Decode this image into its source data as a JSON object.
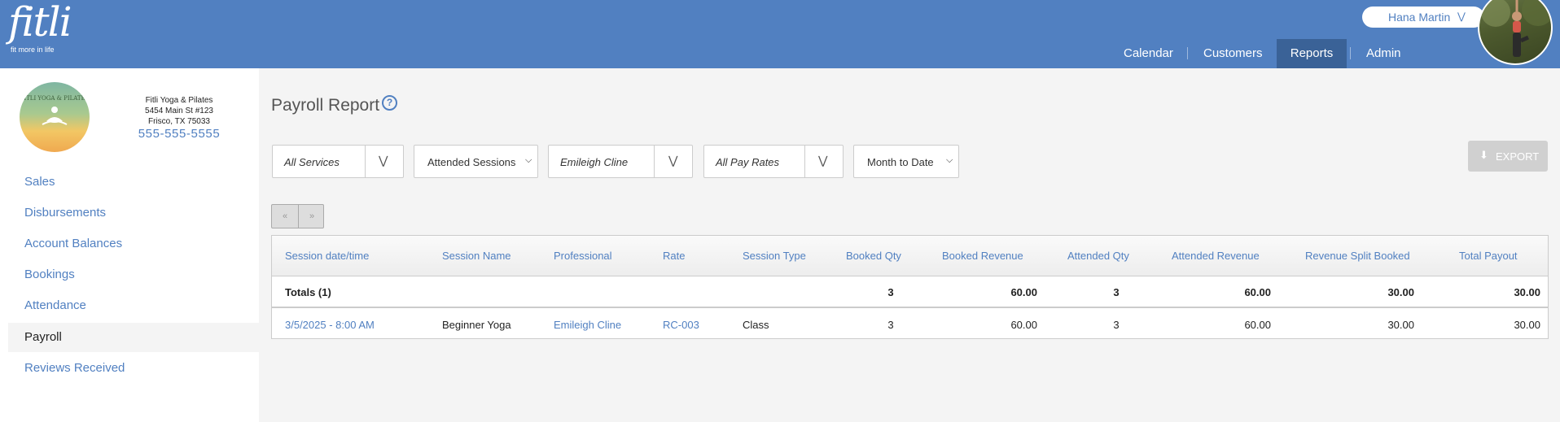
{
  "header": {
    "logo_text": "fitli",
    "logo_tagline": "fit more in life",
    "user_name": "Hana Martin",
    "nav": [
      {
        "label": "Calendar"
      },
      {
        "label": "Customers"
      },
      {
        "label": "Reports",
        "active": true
      },
      {
        "label": "Admin"
      }
    ]
  },
  "studio": {
    "name": "Fitli Yoga & Pilates",
    "address1": "5454 Main St #123",
    "address2": "Frisco, TX 75033",
    "phone": "555-555-5555",
    "logo_text": "FITLI YOGA & PILATES"
  },
  "sidebar": {
    "items": [
      {
        "label": "Sales"
      },
      {
        "label": "Disbursements"
      },
      {
        "label": "Account Balances"
      },
      {
        "label": "Bookings"
      },
      {
        "label": "Attendance"
      },
      {
        "label": "Payroll",
        "active": true
      },
      {
        "label": "Reviews Received"
      }
    ]
  },
  "page": {
    "title": "Payroll Report",
    "help": "?"
  },
  "filters": {
    "services": "All Services",
    "sessions": "Attended Sessions",
    "professional": "Emileigh Cline",
    "pay_rates": "All Pay Rates",
    "date_range": "Month to Date"
  },
  "export_label": "EXPORT",
  "pager": {
    "prev": "«",
    "next": "»"
  },
  "table": {
    "columns": [
      "Session date/time",
      "Session Name",
      "Professional",
      "Rate",
      "Session Type",
      "Booked Qty",
      "Booked Revenue",
      "Attended Qty",
      "Attended Revenue",
      "Revenue Split Booked",
      "Total Payout"
    ],
    "totals": {
      "label": "Totals (1)",
      "booked_qty": "3",
      "booked_revenue": "60.00",
      "attended_qty": "3",
      "attended_revenue": "60.00",
      "revenue_split_booked": "30.00",
      "total_payout": "30.00"
    },
    "rows": [
      {
        "datetime": "3/5/2025 - 8:00 AM",
        "session_name": "Beginner Yoga",
        "professional": "Emileigh Cline",
        "rate": "RC-003",
        "session_type": "Class",
        "booked_qty": "3",
        "booked_revenue": "60.00",
        "attended_qty": "3",
        "attended_revenue": "60.00",
        "revenue_split_booked": "30.00",
        "total_payout": "30.00"
      }
    ]
  },
  "colors": {
    "brand": "#5180c1",
    "nav_active": "#3a6297"
  }
}
